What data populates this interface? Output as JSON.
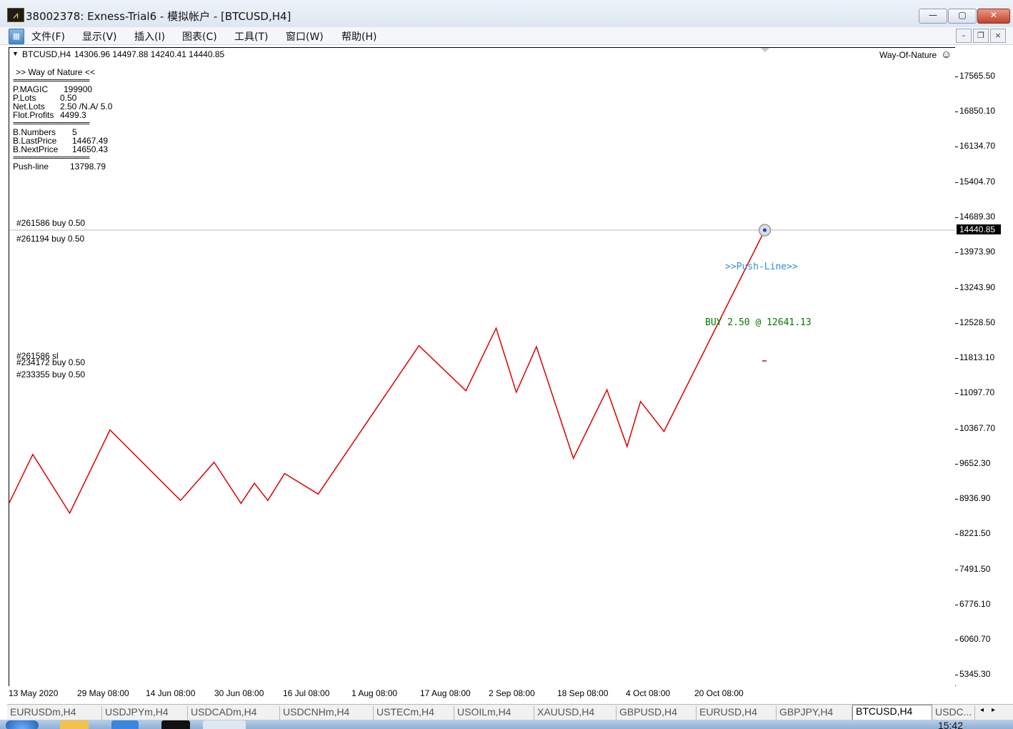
{
  "window": {
    "title": "38002378: Exness-Trial6 - 模拟帐户 - [BTCUSD,H4]",
    "controls": {
      "minimize": "—",
      "maximize": "▢",
      "close": "✕"
    }
  },
  "menu": {
    "items": [
      "文件(F)",
      "显示(V)",
      "插入(I)",
      "图表(C)",
      "工具(T)",
      "窗口(W)",
      "帮助(H)"
    ],
    "mdi_controls": {
      "minimize": "–",
      "restore": "❐",
      "close": "×"
    }
  },
  "chart": {
    "header": {
      "symbol_tf": "BTCUSD,H4",
      "ohlc": "14306.96 14497.88 14240.41 14440.85"
    },
    "ea_name": "Way-Of-Nature",
    "info_panel": {
      "heading": ">> Way of Nature <<",
      "separator": "===================",
      "rows1": [
        {
          "label": "P.MAGIC",
          "value": "199900"
        },
        {
          "label": "P.Lots",
          "value": "0.50"
        },
        {
          "label": "Net.Lots",
          "value": "2.50  /N.A/  5.0"
        },
        {
          "label": "Flot.Profits",
          "value": "4499.3"
        }
      ],
      "rows2": [
        {
          "label": "B.Numbers",
          "value": "5"
        },
        {
          "label": "B.LastPrice",
          "value": "14467.49"
        },
        {
          "label": "B.NextPrice",
          "value": "14650.43"
        }
      ],
      "rows3": [
        {
          "label": "Push-line",
          "value": "13798.79"
        }
      ]
    },
    "order_labels": {
      "o1": "#261586 buy 0.50",
      "o2": "#261194 buy 0.50",
      "o3": "#261586 sl",
      "o4": "#234172 buy 0.50",
      "o5": "#233355 buy 0.50"
    },
    "push_line_label": ">>Push-Line>>",
    "buy_label": "BUY 2.50 @ 12641.13",
    "current_price": "14440.85",
    "line_color": "#dd0000",
    "price_ticks": [
      "17565.50",
      "16850.10",
      "16134.70",
      "15404.70",
      "14689.30",
      "13973.90",
      "13243.90",
      "12528.50",
      "11813.10",
      "11097.70",
      "10367.70",
      "9652.30",
      "8936.90",
      "8221.50",
      "7491.50",
      "6776.10",
      "6060.70",
      "5345.30"
    ],
    "time_ticks": [
      "13 May 2020",
      "29 May 08:00",
      "14 Jun 08:00",
      "30 Jun 08:00",
      "16 Jul 08:00",
      "1 Aug 08:00",
      "17 Aug 08:00",
      "2 Sep 08:00",
      "18 Sep 08:00",
      "4 Oct 08:00",
      "20 Oct 08:00"
    ]
  },
  "chart_data": {
    "type": "line",
    "title": "BTCUSD,H4",
    "x_unit": "bar index",
    "x": [
      0,
      7,
      18,
      30,
      51,
      61,
      69,
      73,
      77,
      82,
      92,
      122,
      136,
      145,
      151,
      157,
      168,
      178,
      184,
      188,
      195,
      225
    ],
    "y": [
      8870,
      9860,
      8660,
      10360,
      8920,
      9700,
      8860,
      9270,
      8920,
      9470,
      9050,
      12080,
      11160,
      12440,
      11130,
      12060,
      9780,
      11180,
      10020,
      10940,
      10330,
      14440.85
    ],
    "ylim": [
      5345.3,
      17565.5
    ],
    "grid": false,
    "series": [
      {
        "name": "BTCUSD,H4",
        "color": "#dd0000"
      }
    ]
  },
  "tabs": [
    "EURUSDm,H4",
    "USDJPYm,H4",
    "USDCADm,H4",
    "USDCNHm,H4",
    "USTECm,H4",
    "USOILm,H4",
    "XAUUSD,H4",
    "GBPUSD,H4",
    "EURUSD,H4",
    "GBPJPY,H4",
    "BTCUSD,H4",
    "USDC..."
  ],
  "active_tab": "BTCUSD,H4",
  "taskbar": {
    "clock": "15:42"
  }
}
